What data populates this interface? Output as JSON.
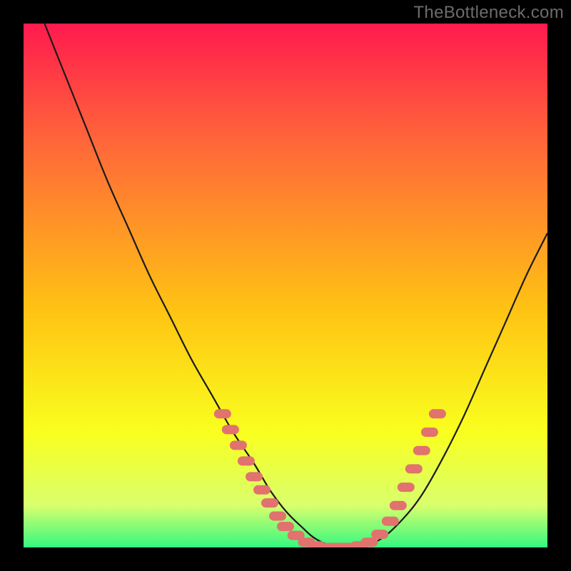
{
  "watermark": "TheBottleneck.com",
  "colors": {
    "bg": "#000000",
    "grad_top": "#ff1a4e",
    "grad_mid1": "#ff653a",
    "grad_mid2": "#ffc413",
    "grad_mid3": "#f9ff1e",
    "grad_low": "#d9ff6e",
    "grad_bot": "#34f87f",
    "curve": "#1a1a1a",
    "marker_fill": "#e1726e",
    "marker_stroke": "#e1726e"
  },
  "chart_data": {
    "type": "line",
    "title": "",
    "xlabel": "",
    "ylabel": "",
    "xlim": [
      0,
      100
    ],
    "ylim": [
      0,
      100
    ],
    "series": [
      {
        "name": "bottleneck-curve",
        "x": [
          4,
          8,
          12,
          16,
          20,
          24,
          28,
          32,
          36,
          40,
          44,
          47,
          50,
          53,
          56,
          60,
          64,
          68,
          72,
          76,
          80,
          84,
          88,
          92,
          96,
          100
        ],
        "y": [
          100,
          90,
          80,
          70,
          61,
          52,
          44,
          36,
          29,
          22,
          16,
          11,
          7,
          4,
          1.5,
          0,
          0,
          1.5,
          5,
          10,
          17,
          25,
          34,
          43,
          52,
          60
        ]
      }
    ],
    "markers": [
      {
        "x": 38,
        "y": 25.5
      },
      {
        "x": 39.5,
        "y": 22.5
      },
      {
        "x": 41,
        "y": 19.5
      },
      {
        "x": 42.5,
        "y": 16.5
      },
      {
        "x": 44,
        "y": 13.5
      },
      {
        "x": 45.5,
        "y": 11
      },
      {
        "x": 47,
        "y": 8.5
      },
      {
        "x": 48.5,
        "y": 6
      },
      {
        "x": 50,
        "y": 4
      },
      {
        "x": 52,
        "y": 2.3
      },
      {
        "x": 54,
        "y": 1
      },
      {
        "x": 56,
        "y": 0.3
      },
      {
        "x": 58,
        "y": 0
      },
      {
        "x": 60,
        "y": 0
      },
      {
        "x": 62,
        "y": 0
      },
      {
        "x": 64,
        "y": 0.3
      },
      {
        "x": 66,
        "y": 1
      },
      {
        "x": 68,
        "y": 2.5
      },
      {
        "x": 70,
        "y": 5
      },
      {
        "x": 71.5,
        "y": 8
      },
      {
        "x": 73,
        "y": 11.5
      },
      {
        "x": 74.5,
        "y": 15
      },
      {
        "x": 76,
        "y": 18.5
      },
      {
        "x": 77.5,
        "y": 22
      },
      {
        "x": 79,
        "y": 25.5
      }
    ]
  }
}
